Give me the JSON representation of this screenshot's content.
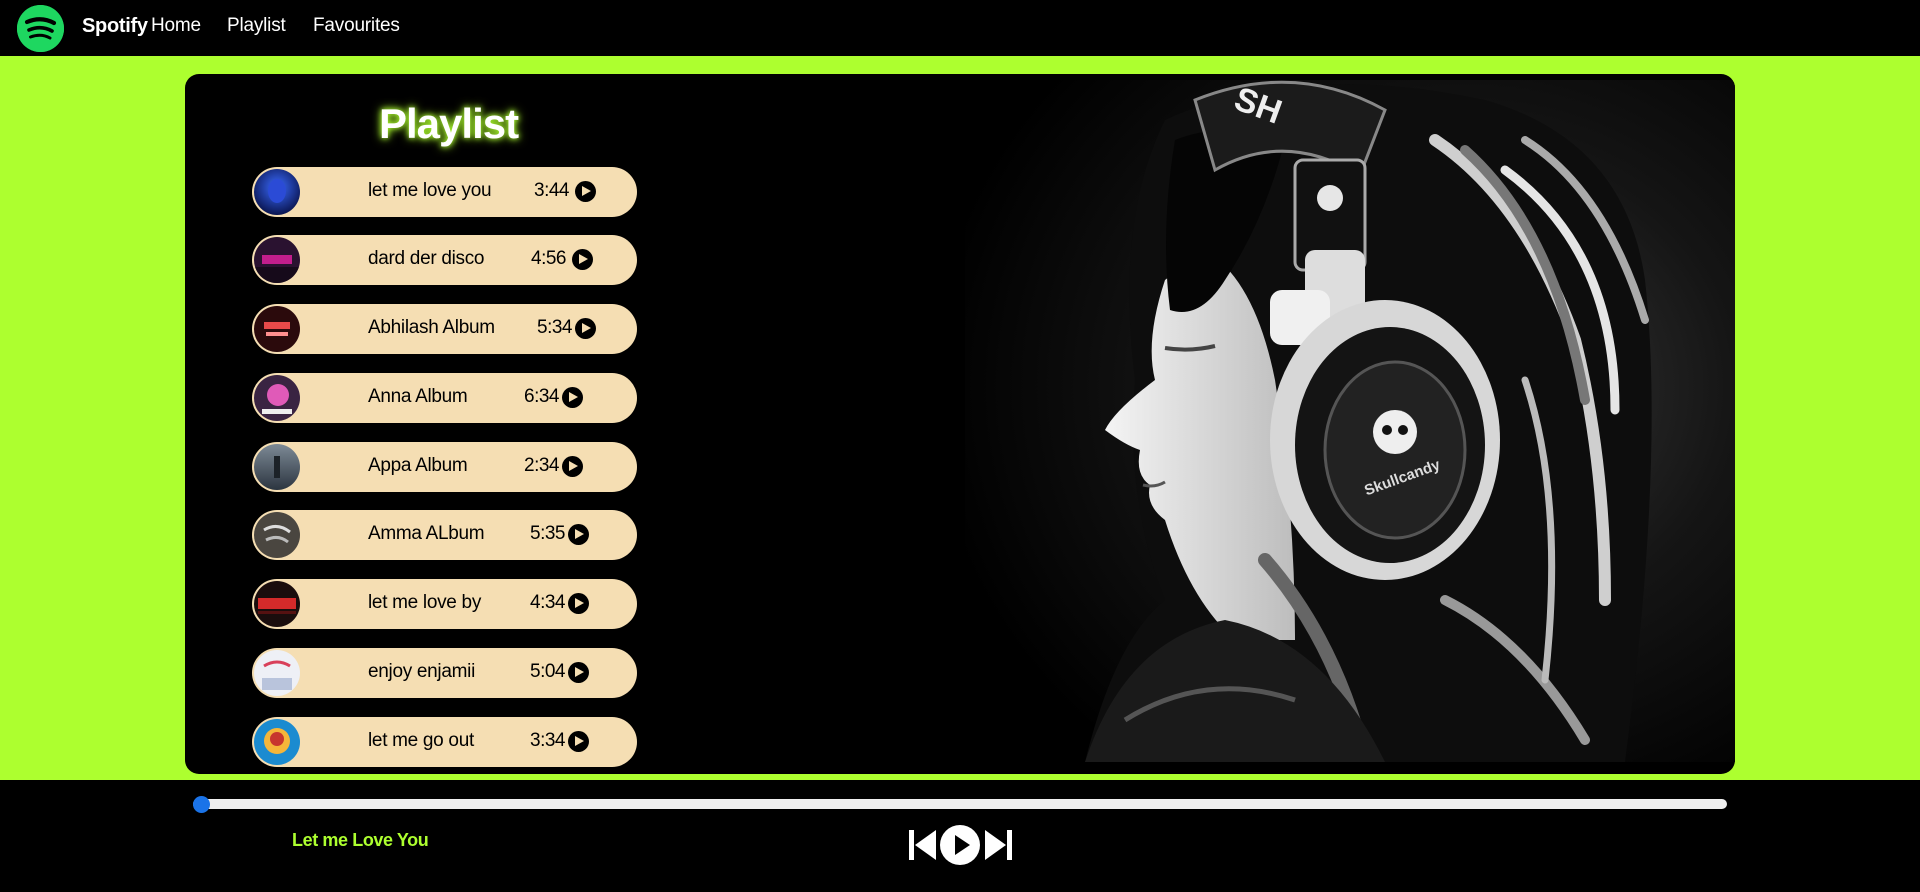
{
  "nav": {
    "brand": "Spotify",
    "links": [
      "Home",
      "Playlist",
      "Favourites"
    ]
  },
  "playlist": {
    "title": "Playlist",
    "songs": [
      {
        "name": "let me love you",
        "duration": "3:44"
      },
      {
        "name": "dard der disco",
        "duration": "4:56"
      },
      {
        "name": "Abhilash Album",
        "duration": "5:34"
      },
      {
        "name": "Anna Album",
        "duration": "6:34"
      },
      {
        "name": "Appa Album",
        "duration": "2:34"
      },
      {
        "name": "Amma ALbum",
        "duration": "5:35"
      },
      {
        "name": "let me love by",
        "duration": "4:34"
      },
      {
        "name": "enjoy enjamii",
        "duration": "5:04"
      },
      {
        "name": "let me go out",
        "duration": "3:34"
      }
    ]
  },
  "player": {
    "now_playing": "Let me Love You",
    "progress": 0
  },
  "colors": {
    "accent": "#adff2f",
    "song_bg": "#f5deb3",
    "bar_bg": "#000000",
    "progress_thumb": "#1a73e8"
  }
}
